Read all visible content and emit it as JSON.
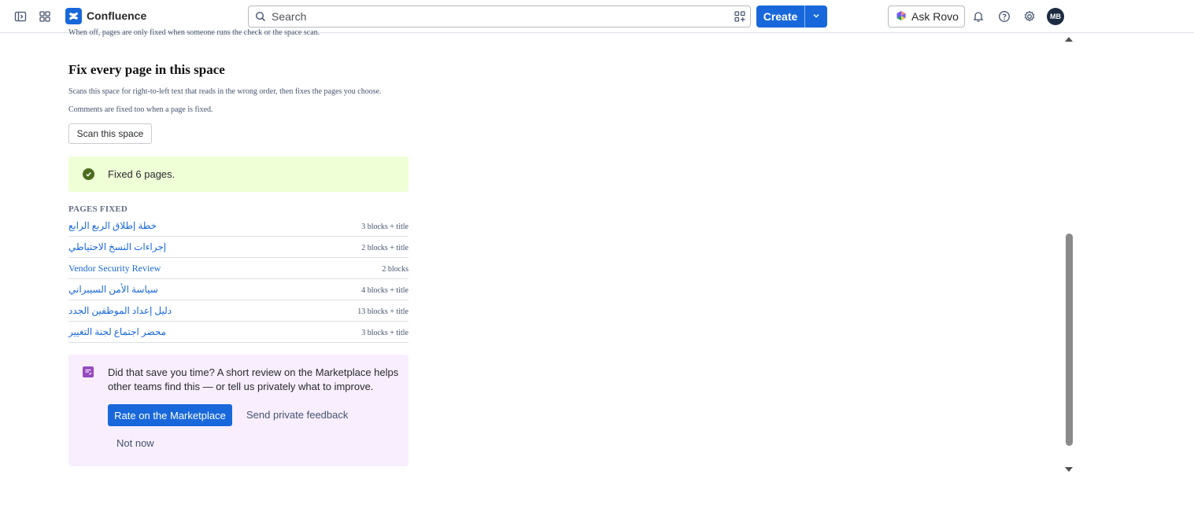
{
  "topbar": {
    "brand": "Confluence",
    "search_placeholder": "Search",
    "create_label": "Create",
    "rovo_label": "Ask Rovo",
    "avatar_initials": "MB",
    "accent_color": "#1868db"
  },
  "section": {
    "cut_off_text": "When off, pages are only fixed when someone runs the check or the space scan.",
    "title": "Fix every page in this space",
    "desc_1": "Scans this space for right-to-left text that reads in the wrong order, then fixes the pages you choose.",
    "desc_2": "Comments are fixed too when a page is fixed.",
    "scan_button": "Scan this space"
  },
  "success": {
    "message": "Fixed 6 pages.",
    "color": "#efffd6"
  },
  "pages_fixed": {
    "label": "PAGES FIXED",
    "rows": [
      {
        "title": "خطة إطلاق الربع الرابع",
        "count": "3 blocks + title"
      },
      {
        "title": "إجراءات النسخ الاحتياطي",
        "count": "2 blocks + title"
      },
      {
        "title": "Vendor Security Review",
        "count": "2 blocks"
      },
      {
        "title": "سياسة الأمن السيبراني",
        "count": "4 blocks + title"
      },
      {
        "title": "دليل إعداد الموظفين الجدد",
        "count": "13 blocks + title"
      },
      {
        "title": "محضر اجتماع لجنة التغيير",
        "count": "3 blocks + title"
      }
    ]
  },
  "feedback": {
    "text": "Did that save you time? A short review on the Marketplace helps other teams find this — or tell us privately what to improve.",
    "rate_button": "Rate on the Marketplace",
    "private_button": "Send private feedback",
    "not_now_button": "Not now",
    "color": "#f8eefe"
  },
  "icons": [
    "sidebar-toggle-icon",
    "app-switcher-icon",
    "confluence-logo-icon",
    "search-icon",
    "apps-icon",
    "chevron-down-icon",
    "rovo-icon",
    "bell-icon",
    "help-icon",
    "gear-icon",
    "check-circle-icon",
    "feedback-icon"
  ]
}
